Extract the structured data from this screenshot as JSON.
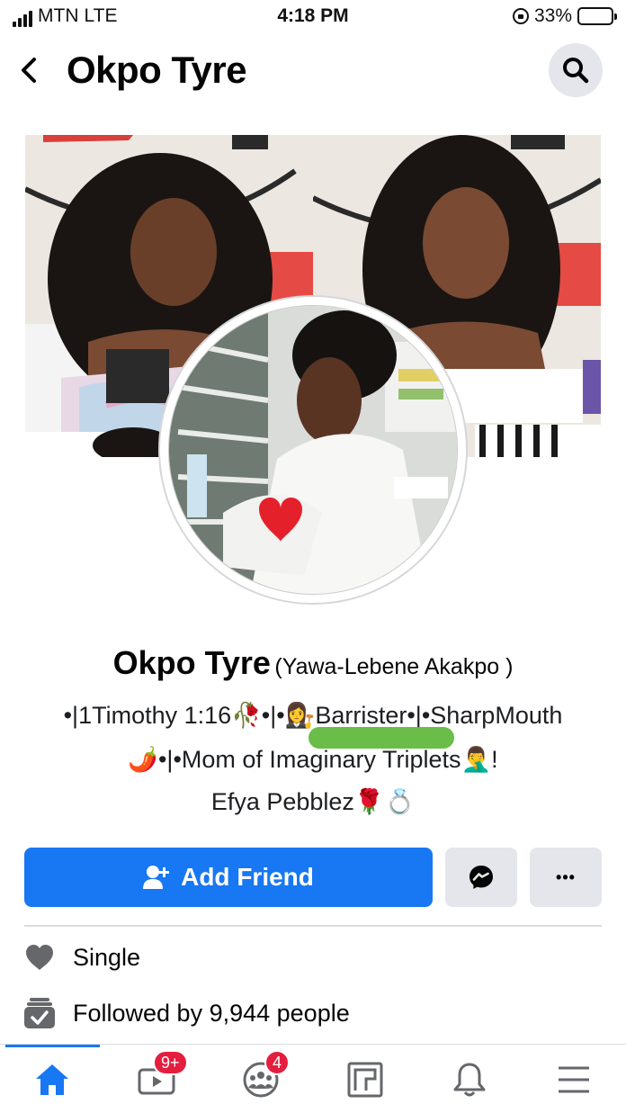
{
  "status_bar": {
    "carrier": "MTN",
    "network": "LTE",
    "time": "4:18 PM",
    "battery": "33%",
    "battery_level": 0.33
  },
  "header": {
    "title": "Okpo Tyre",
    "back_icon": "chevron-left-icon",
    "search_icon": "search-icon"
  },
  "profile": {
    "name": "Okpo Tyre",
    "alternate_name": "(Yawa-Lebene Akakpo )",
    "bio_line1_prefix": "•|1Timothy 1:16",
    "bio_line1_mid": "•|•",
    "bio_line1_suffix": "Barrister•|•SharpMouth",
    "bio_line2_text": "•|•Mom of Imaginary Triplets",
    "bio_line2_end": "!",
    "bio_line3_text": "Efya Pebblez"
  },
  "actions": {
    "add_friend_label": "Add Friend",
    "message_icon": "messenger-icon",
    "more_label": "•••"
  },
  "intro": {
    "relationship": "Single",
    "followers": "Followed by 9,944 people"
  },
  "bottom_nav": {
    "items": [
      {
        "name": "home",
        "icon": "home-icon",
        "badge": ""
      },
      {
        "name": "watch",
        "icon": "video-icon",
        "badge": "9+"
      },
      {
        "name": "groups",
        "icon": "groups-icon",
        "badge": "4"
      },
      {
        "name": "pages",
        "icon": "pages-icon",
        "badge": ""
      },
      {
        "name": "notifications",
        "icon": "bell-icon",
        "badge": ""
      },
      {
        "name": "menu",
        "icon": "menu-icon",
        "badge": ""
      }
    ]
  },
  "colors": {
    "accent": "#1877f2",
    "button_gray": "#e4e6eb",
    "badge_red": "#e41e3f",
    "redaction_green": "#62b93e"
  }
}
